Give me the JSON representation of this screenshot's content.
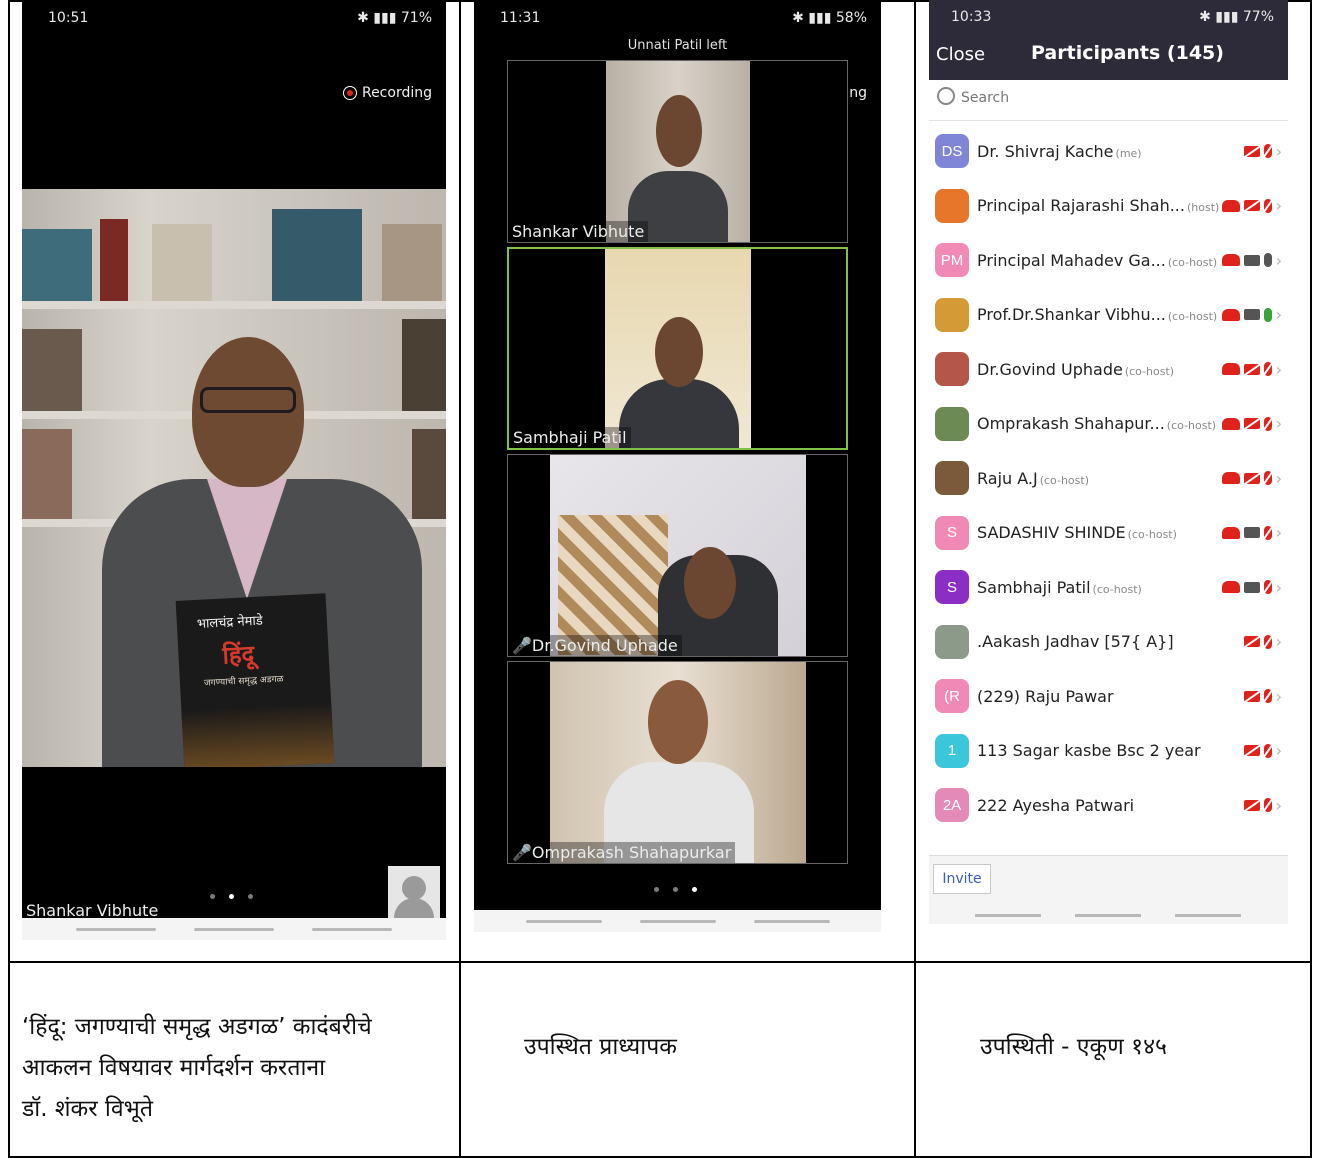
{
  "panel1": {
    "time": "10:51",
    "status_right": "71%",
    "recording_label": "Recording",
    "book_author": "भालचंद्र नेमाडे",
    "book_title": "हिंदू",
    "book_subtitle": "जगण्याची समृद्ध अडगळ",
    "speaker_label": "Shankar Vibhute",
    "page_dots": [
      false,
      true,
      false
    ]
  },
  "panel2": {
    "time": "11:31",
    "status_right": "58%",
    "notice": "Unnati Patil left",
    "recording_label": "Recording",
    "tiles": [
      {
        "name": "Shankar Vibhute"
      },
      {
        "name": "Sambhaji Patil"
      },
      {
        "name": "Dr.Govind Uphade"
      },
      {
        "name": "Omprakash Shahapurkar"
      }
    ],
    "page_dots": [
      false,
      false,
      true
    ]
  },
  "panel3": {
    "time": "10:33",
    "status_right": "77%",
    "close_label": "Close",
    "title": "Participants (145)",
    "search_placeholder": "Search",
    "invite_label": "Invite",
    "participants": [
      {
        "initials": "DS",
        "name": "Dr. Shivraj Kache",
        "tag": "(me)",
        "color": "#7f86d8",
        "hand": false,
        "cam": "off",
        "mic": "off"
      },
      {
        "initials": "",
        "name": "Principal Rajarashi Shah...",
        "tag": "(host)",
        "color": "#e8762a",
        "hand": true,
        "cam": "off",
        "mic": "off"
      },
      {
        "initials": "PM",
        "name": "Principal Mahadev Ga...",
        "tag": "(co-host)",
        "color": "#f08ab4",
        "hand": true,
        "cam": "on",
        "mic": "on"
      },
      {
        "initials": "",
        "name": "Prof.Dr.Shankar Vibhu...",
        "tag": "(co-host)",
        "color": "#d49a36",
        "hand": true,
        "cam": "on",
        "mic": "green"
      },
      {
        "initials": "",
        "name": "Dr.Govind Uphade",
        "tag": "(co-host)",
        "color": "#b4574a",
        "hand": true,
        "cam": "off",
        "mic": "off"
      },
      {
        "initials": "",
        "name": "Omprakash Shahapur...",
        "tag": "(co-host)",
        "color": "#6b8a54",
        "hand": true,
        "cam": "off",
        "mic": "off"
      },
      {
        "initials": "",
        "name": "Raju A.J",
        "tag": "(co-host)",
        "color": "#7a5a3a",
        "hand": true,
        "cam": "off",
        "mic": "off"
      },
      {
        "initials": "S",
        "name": "SADASHIV  SHINDE",
        "tag": "(co-host)",
        "color": "#f08ab4",
        "hand": true,
        "cam": "on",
        "mic": "off"
      },
      {
        "initials": "S",
        "name": "Sambhaji Patil",
        "tag": "(co-host)",
        "color": "#8a2ec4",
        "hand": true,
        "cam": "on",
        "mic": "off"
      },
      {
        "initials": "",
        "name": ".Aakash Jadhav [57{ A}]",
        "tag": "",
        "color": "#8c9a8a",
        "hand": false,
        "cam": "off",
        "mic": "off"
      },
      {
        "initials": "(R",
        "name": "(229) Raju Pawar",
        "tag": "",
        "color": "#f08ab4",
        "hand": false,
        "cam": "off",
        "mic": "off"
      },
      {
        "initials": "1",
        "name": "113  Sagar kasbe Bsc 2 year",
        "tag": "",
        "color": "#3cc6dc",
        "hand": false,
        "cam": "off",
        "mic": "off"
      },
      {
        "initials": "2A",
        "name": "222 Ayesha Patwari",
        "tag": "",
        "color": "#e48ab8",
        "hand": false,
        "cam": "off",
        "mic": "off"
      }
    ]
  },
  "captions": {
    "c1_line1": "‘हिंदू: जगण्याची समृद्ध अडगळ’ कादंबरीचे",
    "c1_line2": "आकलन विषयावर मार्गदर्शन करताना",
    "c1_line3": "डॉ. शंकर विभूते",
    "c2": "उपस्थित प्राध्यापक",
    "c3": "उपस्थिती - एकूण १४५"
  }
}
